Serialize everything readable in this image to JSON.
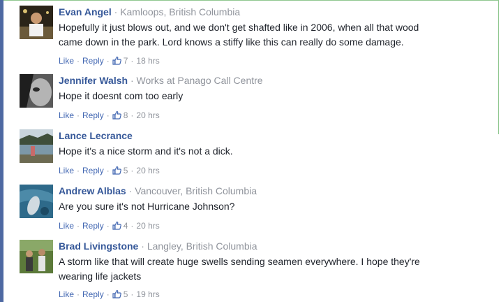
{
  "actions": {
    "like_label": "Like",
    "reply_label": "Reply"
  },
  "comments": [
    {
      "author": "Evan Angel",
      "meta": "Kamloops, British Columbia",
      "text": "Hopefully it just blows out, and we don't get shafted like in 2006, when all that wood\ncame down in the park. Lord knows a stiffy like this can really do some damage.",
      "likes": "7",
      "time": "18 hrs"
    },
    {
      "author": "Jennifer Walsh",
      "meta": "Works at Panago Call Centre",
      "text": "Hope it doesnt com too early",
      "likes": "8",
      "time": "20 hrs"
    },
    {
      "author": "Lance Lecrance",
      "meta": "",
      "text": "Hope it's a nice storm and it's not a dick.",
      "likes": "5",
      "time": "20 hrs"
    },
    {
      "author": "Andrew Alblas",
      "meta": "Vancouver, British Columbia",
      "text": "Are you sure it's not Hurricane Johnson?",
      "likes": "4",
      "time": "20 hrs"
    },
    {
      "author": "Brad Livingstone",
      "meta": "Langley, British Columbia",
      "text": "A storm like that will create huge swells sending seamen everywhere. I hope they're\nwearing life jackets",
      "likes": "5",
      "time": "19 hrs"
    }
  ]
}
